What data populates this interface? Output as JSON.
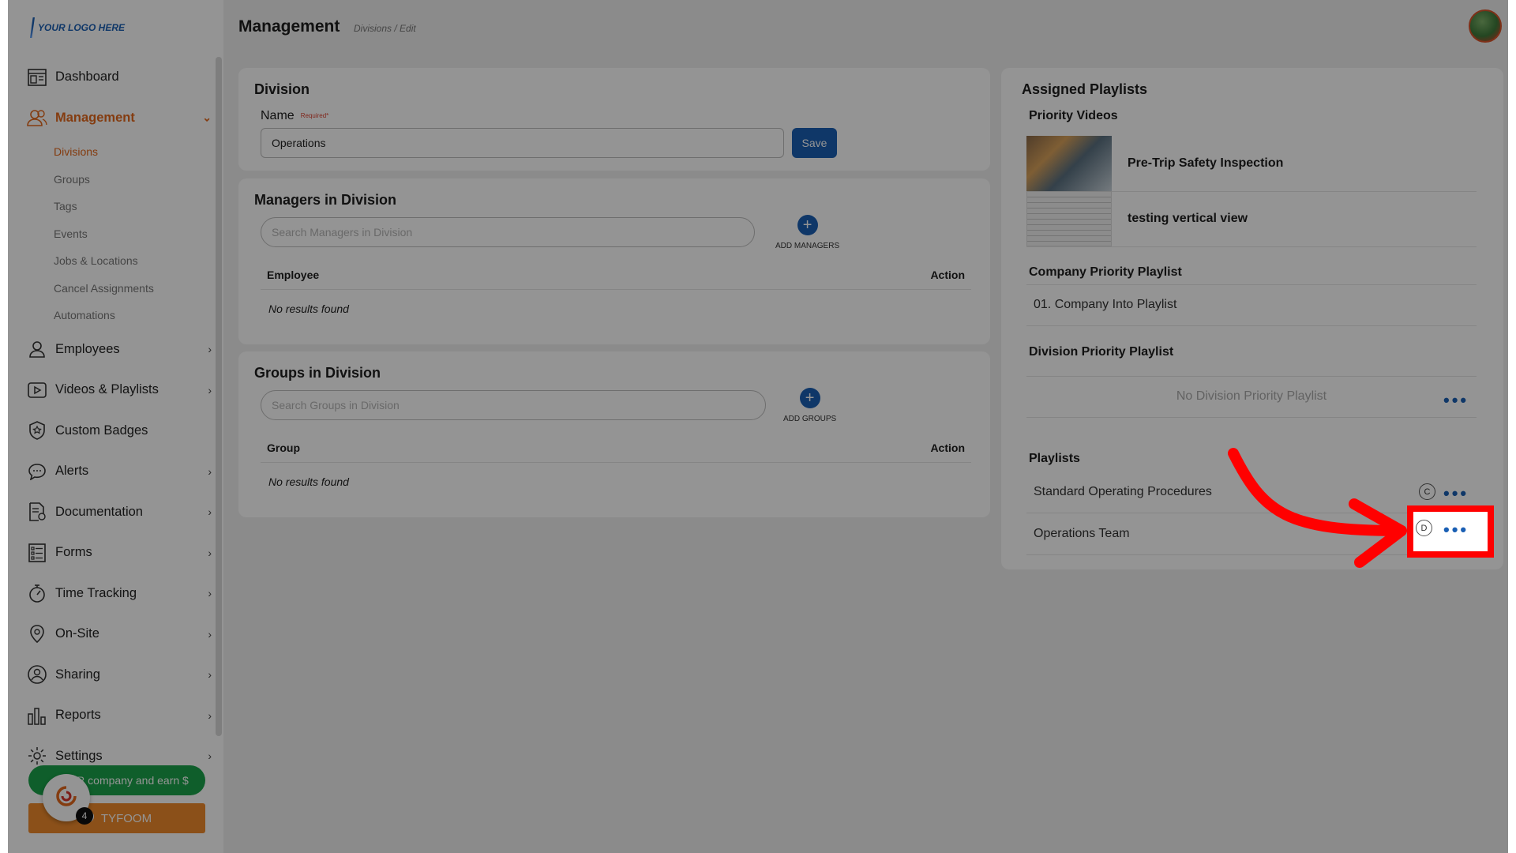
{
  "logo": {
    "text": "YOUR LOGO HERE"
  },
  "header": {
    "title": "Management",
    "breadcrumb": "Divisions  /  Edit"
  },
  "sidebar": {
    "items": [
      {
        "label": "Dashboard",
        "icon": "dashboard-icon"
      },
      {
        "label": "Management",
        "icon": "users-icon",
        "active": true,
        "expanded": true
      },
      {
        "label": "Employees",
        "icon": "person-icon"
      },
      {
        "label": "Videos & Playlists",
        "icon": "play-icon"
      },
      {
        "label": "Custom Badges",
        "icon": "badge-icon"
      },
      {
        "label": "Alerts",
        "icon": "chat-icon"
      },
      {
        "label": "Documentation",
        "icon": "document-icon"
      },
      {
        "label": "Forms",
        "icon": "list-icon"
      },
      {
        "label": "Time Tracking",
        "icon": "stopwatch-icon"
      },
      {
        "label": "On-Site",
        "icon": "location-icon"
      },
      {
        "label": "Sharing",
        "icon": "share-icon"
      },
      {
        "label": "Reports",
        "icon": "bar-chart-icon"
      },
      {
        "label": "Settings",
        "icon": "gear-icon"
      }
    ],
    "sub_items": [
      "Divisions",
      "Groups",
      "Tags",
      "Events",
      "Jobs & Locations",
      "Cancel Assignments",
      "Automations"
    ],
    "refer_label": "R       company and earn $",
    "tyfoom_label": "TYFOOM",
    "bubble_count": "4"
  },
  "division": {
    "title": "Division",
    "name_label": "Name",
    "required_label": "Required*",
    "name_value": "Operations",
    "save_label": "Save"
  },
  "managers": {
    "title": "Managers in Division",
    "search_placeholder": "Search Managers in Division",
    "add_label": "ADD MANAGERS",
    "col_employee": "Employee",
    "col_action": "Action",
    "empty": "No results found"
  },
  "groups": {
    "title": "Groups in Division",
    "search_placeholder": "Search Groups in Division",
    "add_label": "ADD GROUPS",
    "col_group": "Group",
    "col_action": "Action",
    "empty": "No results found"
  },
  "assigned": {
    "title": "Assigned Playlists",
    "priority_videos_title": "Priority Videos",
    "videos": [
      {
        "title": "Pre-Trip Safety Inspection"
      },
      {
        "title": "testing vertical view"
      }
    ],
    "company_title": "Company Priority Playlist",
    "company_item": "01. Company Into Playlist",
    "division_title": "Division Priority Playlist",
    "division_empty": "No Division Priority Playlist",
    "playlists_title": "Playlists",
    "playlists": [
      {
        "name": "Standard Operating Procedures",
        "badge": "C"
      },
      {
        "name": "Operations Team",
        "badge": "D"
      }
    ],
    "more_glyph": "•••"
  },
  "colors": {
    "accent": "#1a5fb4",
    "active": "#e3681c",
    "highlight": "#ff0000",
    "refer": "#1aa34a",
    "tyfoom": "#f08b2c"
  }
}
